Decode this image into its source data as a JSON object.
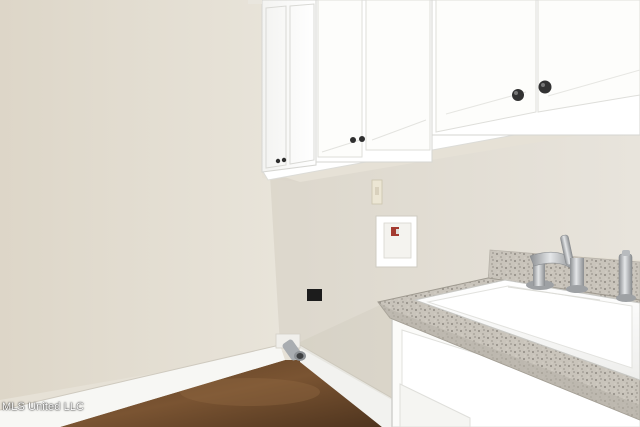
{
  "photo": {
    "watermark": "MLS United LLC",
    "subject_elements": [
      "left-wall",
      "back-wall",
      "upper-cabinets",
      "cabinet-knobs",
      "light-switch",
      "washer-outlet-box",
      "dryer-vent-pipe",
      "baseboard",
      "concrete-floor",
      "granite-countertop",
      "utility-sink",
      "sink-faucet",
      "soap-dispenser",
      "lower-cabinet"
    ]
  }
}
